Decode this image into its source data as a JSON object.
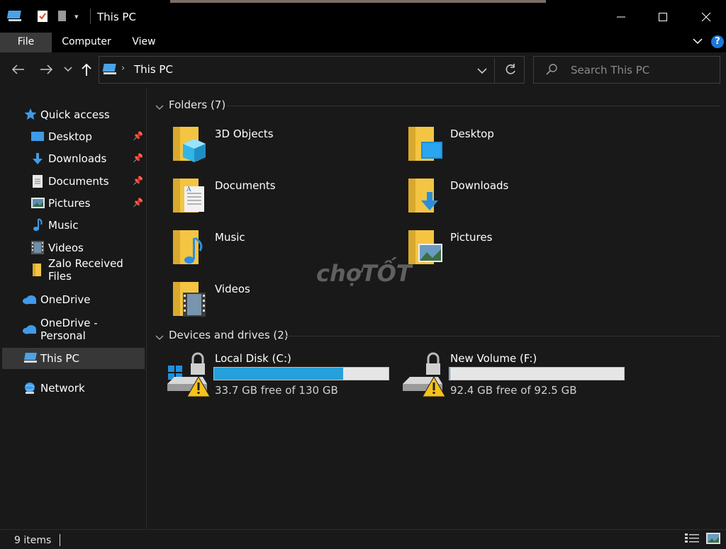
{
  "window": {
    "title": "This PC",
    "minimize": "—",
    "maximize": "☐",
    "close": "✕"
  },
  "ribbon": {
    "tabs": [
      {
        "label": "File"
      },
      {
        "label": "Computer"
      },
      {
        "label": "View"
      }
    ],
    "help": "?"
  },
  "address": {
    "location": "This PC"
  },
  "search": {
    "placeholder": "Search This PC"
  },
  "sidebar": {
    "items": [
      {
        "label": "Quick access"
      },
      {
        "label": "Desktop",
        "pinned": true
      },
      {
        "label": "Downloads",
        "pinned": true
      },
      {
        "label": "Documents",
        "pinned": true
      },
      {
        "label": "Pictures",
        "pinned": true
      },
      {
        "label": "Music"
      },
      {
        "label": "Videos"
      },
      {
        "label": "Zalo Received Files"
      },
      {
        "label": "OneDrive"
      },
      {
        "label": "OneDrive - Personal"
      },
      {
        "label": "This PC",
        "selected": true
      },
      {
        "label": "Network"
      }
    ]
  },
  "folders": {
    "header": "Folders (7)",
    "items": [
      {
        "label": "3D Objects"
      },
      {
        "label": "Desktop"
      },
      {
        "label": "Documents"
      },
      {
        "label": "Downloads"
      },
      {
        "label": "Music"
      },
      {
        "label": "Pictures"
      },
      {
        "label": "Videos"
      }
    ]
  },
  "drives": {
    "header": "Devices and drives (2)",
    "items": [
      {
        "label": "Local Disk (C:)",
        "free": "33.7 GB free of 130 GB",
        "used_fraction": 0.74
      },
      {
        "label": "New Volume (F:)",
        "free": "92.4 GB free of 92.5 GB",
        "used_fraction": 0.001
      }
    ]
  },
  "status": {
    "items": "9 items"
  },
  "watermark": {
    "text": "chợTỐT"
  },
  "colors": {
    "accent": "#26a0da",
    "folder": "#f4c542",
    "background": "#191919"
  }
}
